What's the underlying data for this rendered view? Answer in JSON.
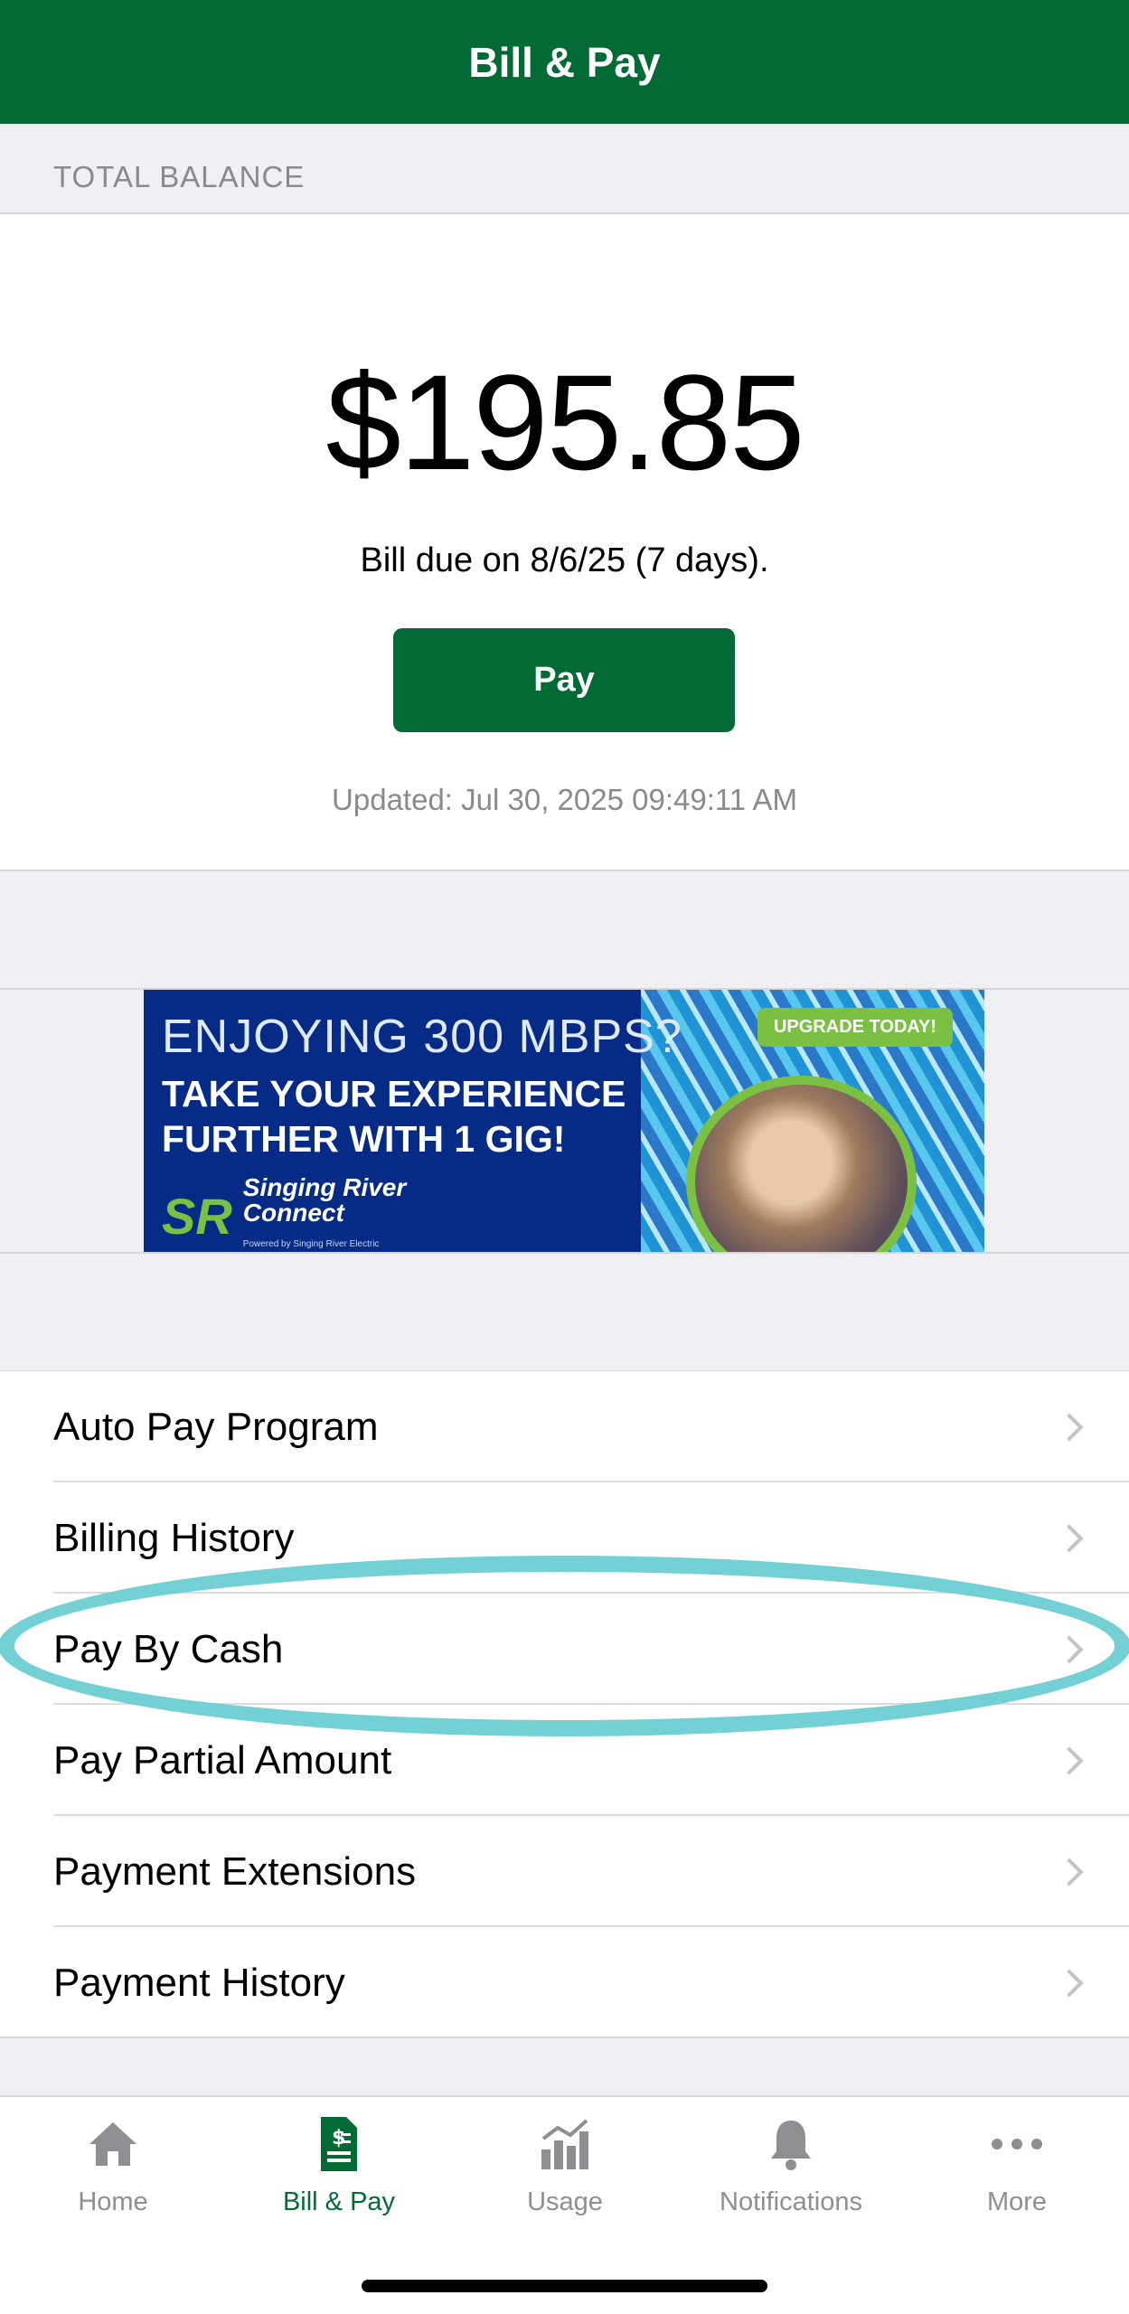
{
  "header": {
    "title": "Bill & Pay"
  },
  "balance": {
    "section_label": "TOTAL BALANCE",
    "amount": "$195.85",
    "due_text": "Bill due on 8/6/25 (7 days).",
    "pay_label": "Pay",
    "updated_text": "Updated: Jul 30, 2025 09:49:11 AM"
  },
  "banner": {
    "line1": "ENJOYING 300 MBPS?",
    "line2": "TAKE YOUR EXPERIENCE",
    "line3": "FURTHER WITH 1 GIG!",
    "badge": "UPGRADE TODAY!",
    "logo_mark": "SR",
    "logo_line1": "Singing River",
    "logo_line2": "Connect",
    "logo_sub": "Powered by Singing River Electric"
  },
  "menu": {
    "items": [
      {
        "label": "Auto Pay Program"
      },
      {
        "label": "Billing History"
      },
      {
        "label": "Pay By Cash"
      },
      {
        "label": "Pay Partial Amount"
      },
      {
        "label": "Payment Extensions"
      },
      {
        "label": "Payment History"
      }
    ]
  },
  "tabbar": {
    "tabs": [
      {
        "label": "Home",
        "icon": "home-icon"
      },
      {
        "label": "Bill & Pay",
        "icon": "bill-icon",
        "active": true
      },
      {
        "label": "Usage",
        "icon": "usage-chart-icon"
      },
      {
        "label": "Notifications",
        "icon": "bell-icon"
      },
      {
        "label": "More",
        "icon": "more-dots-icon"
      }
    ]
  },
  "colors": {
    "brand": "#016a35",
    "highlight": "#73d0d4",
    "inactive": "#8e8e93"
  }
}
